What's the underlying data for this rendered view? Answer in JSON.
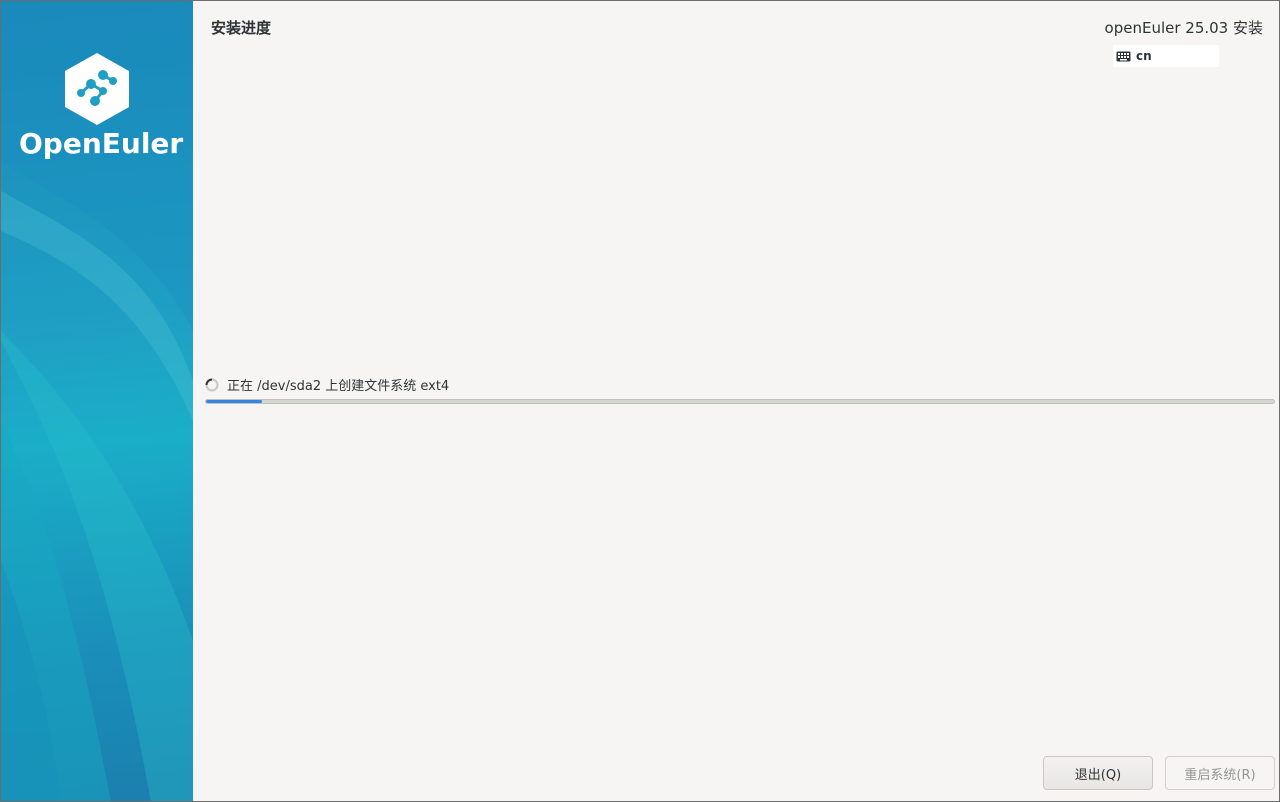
{
  "sidebar": {
    "logo_text": "OpenEuler",
    "logo_icon": "openeuler-logo-icon"
  },
  "header": {
    "page_title": "安装进度",
    "product_title": "openEuler 25.03 安装",
    "keyboard_layout": "cn",
    "keyboard_icon": "keyboard-icon"
  },
  "progress": {
    "status_text": "正在 /dev/sda2 上创建文件系统 ext4",
    "fraction": 0.052,
    "spinner_icon": "spinner-icon"
  },
  "footer": {
    "quit_label": "退出(Q)",
    "reboot_label": "重启系统(R)"
  },
  "colors": {
    "accent": "#3584e4",
    "sidebar": "#1f9fc4"
  }
}
